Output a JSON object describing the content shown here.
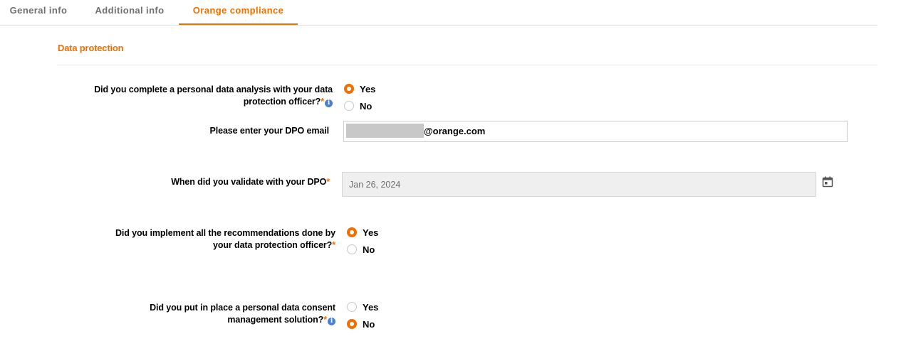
{
  "tabs": [
    "General info",
    "Additional info",
    "Orange compliance"
  ],
  "active_tab": "Orange compliance",
  "section": {
    "title": "Data protection"
  },
  "questions": {
    "q1": {
      "line1": "Did you complete a personal data analysis with your data",
      "line2": "protection officer?",
      "required_mark": "*",
      "options": [
        "Yes",
        "No"
      ],
      "selected": "Yes"
    },
    "dpo_email": {
      "label": "Please enter your DPO email",
      "value_suffix": "@orange.com"
    },
    "validation_date": {
      "label": "When did you validate with your DPO",
      "required_mark": "*",
      "value": "Jan 26, 2024"
    },
    "q2": {
      "line1": "Did you implement all the recommendations done by",
      "line2": "your data protection officer?",
      "required_mark": "*",
      "options": [
        "Yes",
        "No"
      ],
      "selected": "Yes"
    },
    "q3": {
      "line1": "Did you put in place a personal data consent",
      "line2": "management solution?",
      "required_mark": "*",
      "options": [
        "Yes",
        "No"
      ],
      "selected": "No"
    }
  },
  "info_glyph": "i",
  "icons": {
    "info": "info-icon",
    "calendar": "calendar-icon"
  },
  "colors": {
    "accent": "#f16e00",
    "info": "#4a7fd1"
  }
}
